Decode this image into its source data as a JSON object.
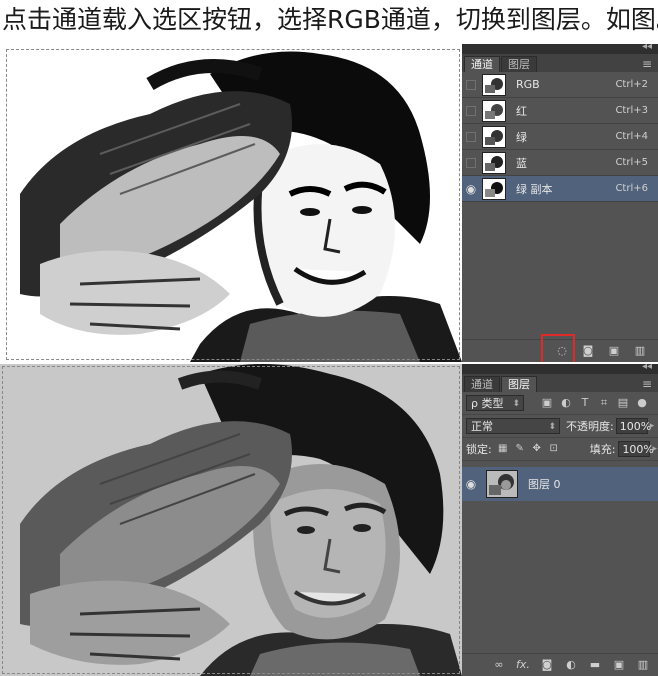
{
  "caption": "点击通道载入选区按钮，选择RGB通道，切换到图层。如图。",
  "channels_panel": {
    "tabs": [
      "通道",
      "图层"
    ],
    "active_tab": 0,
    "menu_glyph": "≡",
    "collapse_glyph": "◂◂",
    "channels": [
      {
        "name": "RGB",
        "shortcut": "Ctrl+2",
        "visible": false,
        "selected": false
      },
      {
        "name": "红",
        "shortcut": "Ctrl+3",
        "visible": false,
        "selected": false
      },
      {
        "name": "绿",
        "shortcut": "Ctrl+4",
        "visible": false,
        "selected": false
      },
      {
        "name": "蓝",
        "shortcut": "Ctrl+5",
        "visible": false,
        "selected": false
      },
      {
        "name": "绿 副本",
        "shortcut": "Ctrl+6",
        "visible": true,
        "selected": true
      }
    ],
    "bottom_icons": [
      "load-selection-icon",
      "save-selection-icon",
      "new-channel-icon",
      "trash-icon"
    ],
    "highlight_color": "#e02a2a"
  },
  "layers_panel": {
    "tabs": [
      "通道",
      "图层"
    ],
    "active_tab": 1,
    "menu_glyph": "≡",
    "collapse_glyph": "◂◂",
    "filter_label": "ρ 类型",
    "blend_mode": "正常",
    "opacity_label": "不透明度:",
    "opacity_value": "100%",
    "lock_label": "锁定:",
    "fill_label": "填充:",
    "fill_value": "100%",
    "layers": [
      {
        "name": "图层 0",
        "visible": true,
        "selected": true
      }
    ],
    "bottom_icons": [
      "link-icon",
      "fx-icon",
      "mask-icon",
      "adjustment-icon",
      "folder-icon",
      "new-layer-icon",
      "trash-icon"
    ],
    "fx_text": "fx."
  },
  "colors": {
    "panel_bg": "#535353",
    "selected_row": "#50627c",
    "canvas_bg2": "#c8c8c8"
  }
}
